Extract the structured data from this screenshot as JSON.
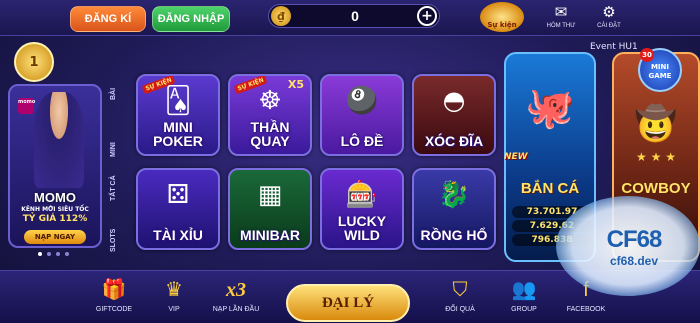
{
  "header": {
    "register_label": "ĐĂNG KÍ",
    "login_label": "ĐĂNG NHẬP",
    "balance": "0",
    "event_icon_label": "Sự kiện",
    "mail_label": "HÒM THƯ",
    "settings_label": "CÀI ĐẶT"
  },
  "promo": {
    "brand": "momo",
    "title": "MOMO",
    "subtitle": "KÊNH MỚI SIÊU TỐC",
    "rate": "TỶ GIÁ 112%",
    "button": "NẠP NGAY"
  },
  "categories": [
    "BÀI",
    "MINI",
    "TẤT CẢ",
    "SLOTS"
  ],
  "games": [
    {
      "label": "MINI POKER",
      "badge": "SỰ KIỆN"
    },
    {
      "label": "THẦN QUAY",
      "badge": "SỰ KIỆN",
      "multiplier": "X5"
    },
    {
      "label": "LÔ ĐỀ"
    },
    {
      "label": "XÓC ĐĨA"
    },
    {
      "label": "TÀI XỈU"
    },
    {
      "label": "MINIBAR"
    },
    {
      "label": "LUCKY WILD"
    },
    {
      "label": "RỒNG HỔ"
    }
  ],
  "fish": {
    "title": "BẮN CÁ",
    "new_tag": "NEW",
    "jackpots": [
      "73.701.97",
      "7.629.62",
      "796.838"
    ]
  },
  "cowboy": {
    "title": "COWBOY"
  },
  "event_text": "Event HU1",
  "minigame": {
    "label": "MINI GAME",
    "count": "30"
  },
  "level": "1",
  "bottom_nav": {
    "giftcode": "GIFTCODE",
    "vip": "VIP",
    "first_topup": "NẠP LẦN ĐẦU",
    "first_topup_badge": "x3",
    "agent": "ĐẠI LÝ",
    "rewards": "ĐỔI QUÀ",
    "group": "GROUP",
    "facebook": "FACEBOOK"
  },
  "watermark": {
    "logo": "CF68",
    "url": "cf68.dev"
  }
}
